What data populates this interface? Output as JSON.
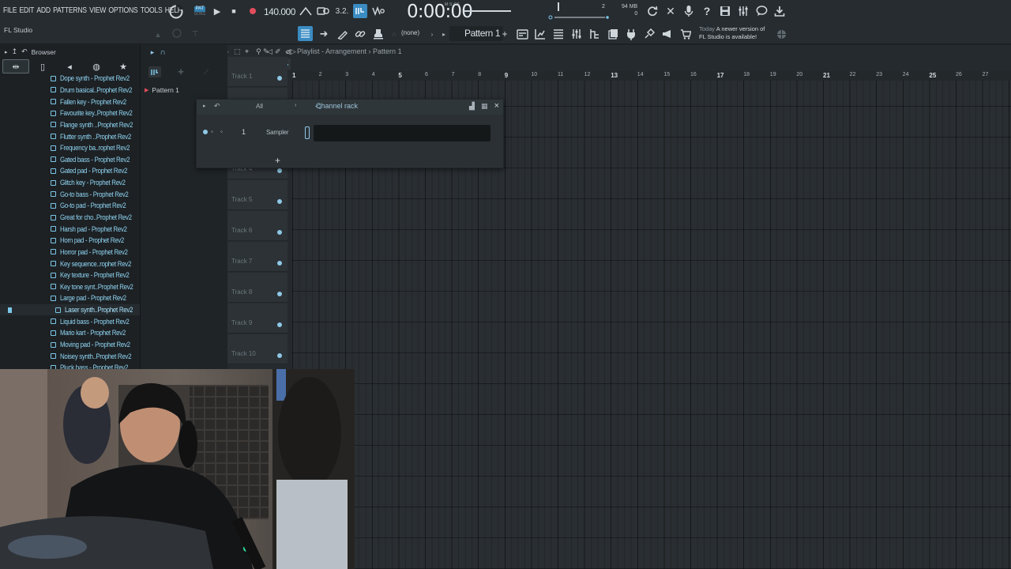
{
  "menu": [
    "FILE",
    "EDIT",
    "ADD",
    "PATTERNS",
    "VIEW",
    "OPTIONS",
    "TOOLS",
    "HELP"
  ],
  "app_label": "FL Studio",
  "transport": {
    "mode_label": "PAT",
    "mode_alt_label": "SONG",
    "tempo": "140.000",
    "time": "0:00:00",
    "time_unit": "M:S:CS"
  },
  "status": {
    "memory": "94 MB",
    "cpu": "0",
    "polyphony": "2"
  },
  "toolbar2": {
    "snap": "(none)",
    "pattern": "Pattern 1"
  },
  "news": {
    "date": "Today",
    "line1": "A newer version of",
    "line2": "FL Studio is available!"
  },
  "browser": {
    "title": "Browser",
    "selected_index": 19,
    "files": [
      "Dope synth - Prophet Rev2",
      "Drum basical..Prophet Rev2",
      "Fallen key - Prophet Rev2",
      "Favourite key..Prophet Rev2",
      "Flange synth ..Prophet Rev2",
      "Flutter synth ..Prophet Rev2",
      "Frequency ba..rophet Rev2",
      "Gated bass - Prophet Rev2",
      "Gated pad - Prophet Rev2",
      "Glitch key - Prophet Rev2",
      "Go-to bass - Prophet Rev2",
      "Go-to pad - Prophet Rev2",
      "Great for cho..Prophet Rev2",
      "Harsh pad - Prophet Rev2",
      "Horn pad - Prophet Rev2",
      "Horror pad - Prophet Rev2",
      "Key sequence..rophet Rev2",
      "Key texture - Prophet Rev2",
      "Key tone synt..Prophet Rev2",
      "Large pad - Prophet Rev2",
      "Laser synth..Prophet Rev2",
      "Liquid bass - Prophet Rev2",
      "Mario kart - Prophet Rev2",
      "Moving pad - Prophet Rev2",
      "Noisey synth..Prophet Rev2",
      "Pluck bass - Prophet Rev2"
    ]
  },
  "picker": {
    "pattern_item": "Pattern 1"
  },
  "playlist": {
    "title": "Playlist - Arrangement",
    "pattern": "Pattern 1",
    "ruler": [
      "1",
      "2",
      "3",
      "4",
      "5",
      "6",
      "7",
      "8",
      "9",
      "10",
      "11",
      "12",
      "13",
      "14",
      "15",
      "16",
      "17",
      "18",
      "19",
      "20",
      "21",
      "22",
      "23",
      "24",
      "25",
      "26",
      "27"
    ],
    "tracks": [
      "Track 1",
      "Track 2",
      "Track 3",
      "Track 4",
      "Track 5",
      "Track 6",
      "Track 7",
      "Track 8",
      "Track 9",
      "Track 10"
    ]
  },
  "channel_rack": {
    "title": "Channel rack",
    "filter": "All",
    "channel_number": "1",
    "channel_name": "Sampler"
  },
  "colors": {
    "accent": "#7cc7e9",
    "record": "#e24d5b",
    "background": "#1e2326"
  }
}
